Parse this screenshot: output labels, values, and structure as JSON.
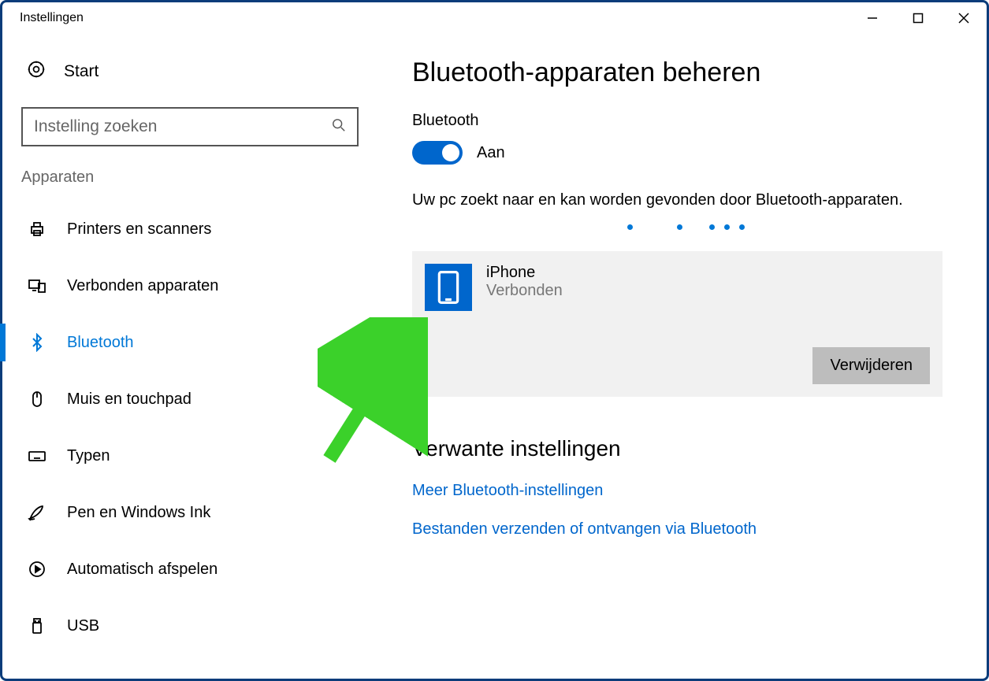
{
  "window": {
    "title": "Instellingen"
  },
  "sidebar": {
    "start": "Start",
    "search_placeholder": "Instelling zoeken",
    "category": "Apparaten",
    "items": [
      {
        "label": "Printers en scanners"
      },
      {
        "label": "Verbonden apparaten"
      },
      {
        "label": "Bluetooth"
      },
      {
        "label": "Muis en touchpad"
      },
      {
        "label": "Typen"
      },
      {
        "label": "Pen en Windows Ink"
      },
      {
        "label": "Automatisch afspelen"
      },
      {
        "label": "USB"
      }
    ]
  },
  "main": {
    "heading": "Bluetooth-apparaten beheren",
    "bt_label": "Bluetooth",
    "toggle_state": "Aan",
    "scan_text": "Uw pc zoekt naar en kan worden gevonden door Bluetooth-apparaten.",
    "device": {
      "name": "iPhone",
      "status": "Verbonden",
      "remove": "Verwijderen"
    },
    "related_heading": "Verwante instellingen",
    "links": [
      "Meer Bluetooth-instellingen",
      "Bestanden verzenden of ontvangen via Bluetooth"
    ]
  }
}
